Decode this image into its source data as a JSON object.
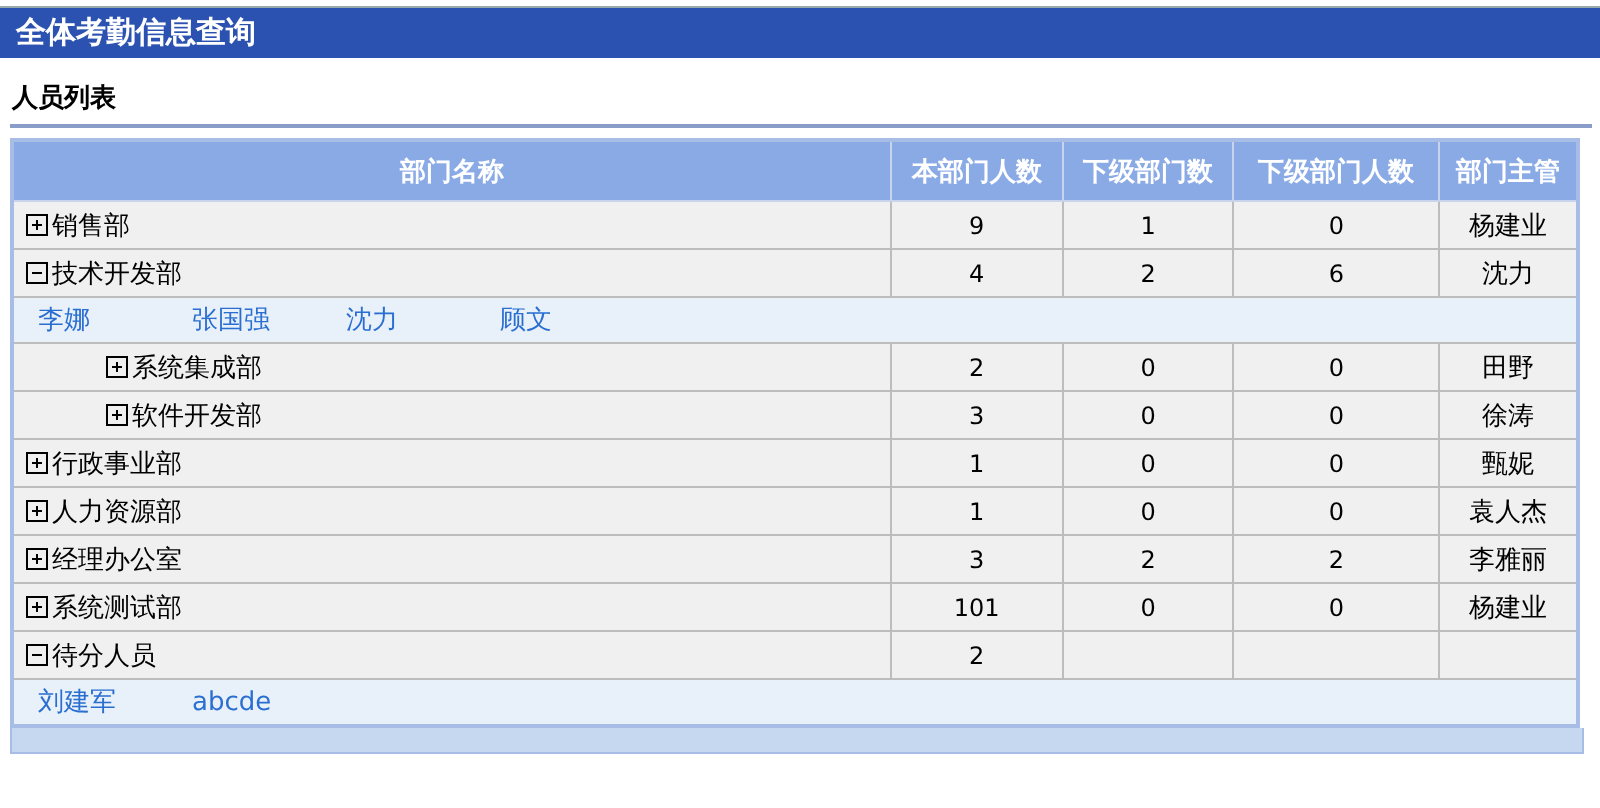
{
  "window": {
    "title": "全体考勤信息查询"
  },
  "section": {
    "title": "人员列表"
  },
  "table": {
    "columns": [
      "部门名称",
      "本部门人数",
      "下级部门数",
      "下级部门人数",
      "部门主管"
    ],
    "rows": [
      {
        "name": "销售部",
        "expanded": false,
        "count": "9",
        "sub_depts": "1",
        "sub_people": "0",
        "manager": "杨建业"
      },
      {
        "name": "技术开发部",
        "expanded": true,
        "count": "4",
        "sub_depts": "2",
        "sub_people": "6",
        "manager": "沈力",
        "members": [
          "李娜",
          "张国强",
          "沈力",
          "顾文"
        ],
        "children": [
          {
            "name": "系统集成部",
            "expanded": false,
            "count": "2",
            "sub_depts": "0",
            "sub_people": "0",
            "manager": "田野"
          },
          {
            "name": "软件开发部",
            "expanded": false,
            "count": "3",
            "sub_depts": "0",
            "sub_people": "0",
            "manager": "徐涛"
          }
        ]
      },
      {
        "name": "行政事业部",
        "expanded": false,
        "count": "1",
        "sub_depts": "0",
        "sub_people": "0",
        "manager": "甄妮"
      },
      {
        "name": "人力资源部",
        "expanded": false,
        "count": "1",
        "sub_depts": "0",
        "sub_people": "0",
        "manager": "袁人杰"
      },
      {
        "name": "经理办公室",
        "expanded": false,
        "count": "3",
        "sub_depts": "2",
        "sub_people": "2",
        "manager": "李雅丽"
      },
      {
        "name": "系统测试部",
        "expanded": false,
        "count": "101",
        "sub_depts": "0",
        "sub_people": "0",
        "manager": "杨建业"
      },
      {
        "name": "待分人员",
        "expanded": true,
        "count": "2",
        "members": [
          "刘建军",
          "abcde"
        ]
      }
    ]
  }
}
